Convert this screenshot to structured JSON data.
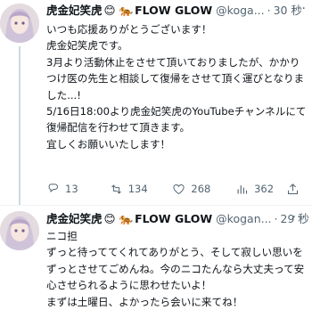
{
  "tweets": [
    {
      "author_name": "虎金妃笑虎",
      "author_emoji_1": "😊",
      "author_emoji_2": "🐅",
      "author_suffix": "FLOW GLOW",
      "handle": "@koga...",
      "time": "30 秒",
      "more_label": "···",
      "body": [
        "いつも応援ありがとうございます！",
        "虎金妃笑虎です。",
        "",
        "3月より活動休止をさせて頂いておりましたが、かかりつけ医の先生と相談して復帰をさせて頂く運びとなりました...!",
        "",
        "5/16日18:00より虎金妃笑虎のYouTubeチャンネルにて復帰配信を行わせて頂きます。",
        "",
        "宜しくお願いいたします！"
      ],
      "actions": {
        "reply_count": "13",
        "retweet_count": "134",
        "like_count": "268",
        "view_count": "362"
      }
    },
    {
      "author_name": "虎金妃笑虎",
      "author_emoji_1": "😊",
      "author_emoji_2": "🐅",
      "author_suffix": "FLOW GLOW",
      "handle": "@kogan...",
      "time": "29 秒",
      "more_label": "···",
      "body": [
        "ニコ担",
        "ずっと待っててくれてありがとう、そして寂しい思いをずっとさせてごめんね。今のニコたんなら大丈夫って安心させられるように思わせたいよ！",
        "まずは土曜日、よかったら会いに来てね！"
      ]
    }
  ]
}
